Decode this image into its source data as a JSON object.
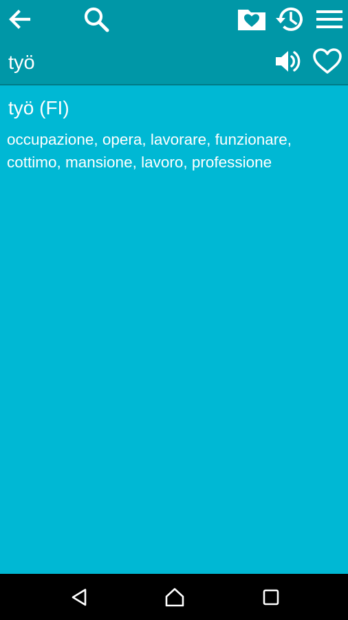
{
  "toolbar": {
    "icons": [
      "back-arrow-icon",
      "search-icon",
      "favorites-folder-icon",
      "history-icon",
      "menu-icon"
    ]
  },
  "subbar": {
    "word": "työ",
    "icons": [
      "speaker-icon",
      "heart-outline-icon"
    ]
  },
  "entry": {
    "title": "työ (FI)",
    "translations": "occupazione, opera, lavorare, funzionare, cottimo, mansione, lavoro, professione"
  },
  "navbar": {
    "icons": [
      "nav-back-icon",
      "nav-home-icon",
      "nav-recents-icon"
    ]
  },
  "colors": {
    "toolbar": "#0097a7",
    "content": "#00b8d4",
    "text": "#ffffff",
    "navbar": "#000000"
  }
}
